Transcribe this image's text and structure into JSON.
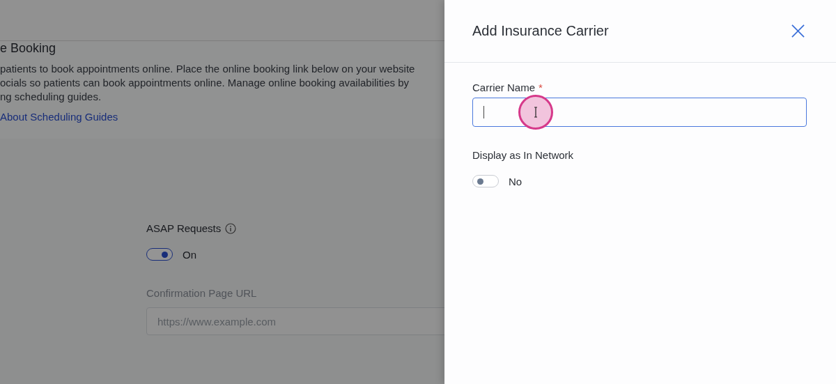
{
  "background_page": {
    "heading": "e Booking",
    "description_lines": [
      "patients to book appointments online. Place the online booking link below on your website",
      "ocials so patients can book appointments online. Manage online booking availabilities by",
      "ng scheduling guides."
    ],
    "link": "About Scheduling Guides",
    "asap": {
      "label": "ASAP Requests",
      "on": true,
      "state_text": "On"
    },
    "confirmation": {
      "label": "Confirmation Page URL",
      "placeholder": "https://www.example.com"
    }
  },
  "drawer": {
    "title": "Add Insurance Carrier",
    "carrier_name": {
      "label": "Carrier Name",
      "required_mark": "*",
      "focused": true
    },
    "in_network": {
      "label": "Display as In Network",
      "on": false,
      "state_text": "No"
    }
  }
}
